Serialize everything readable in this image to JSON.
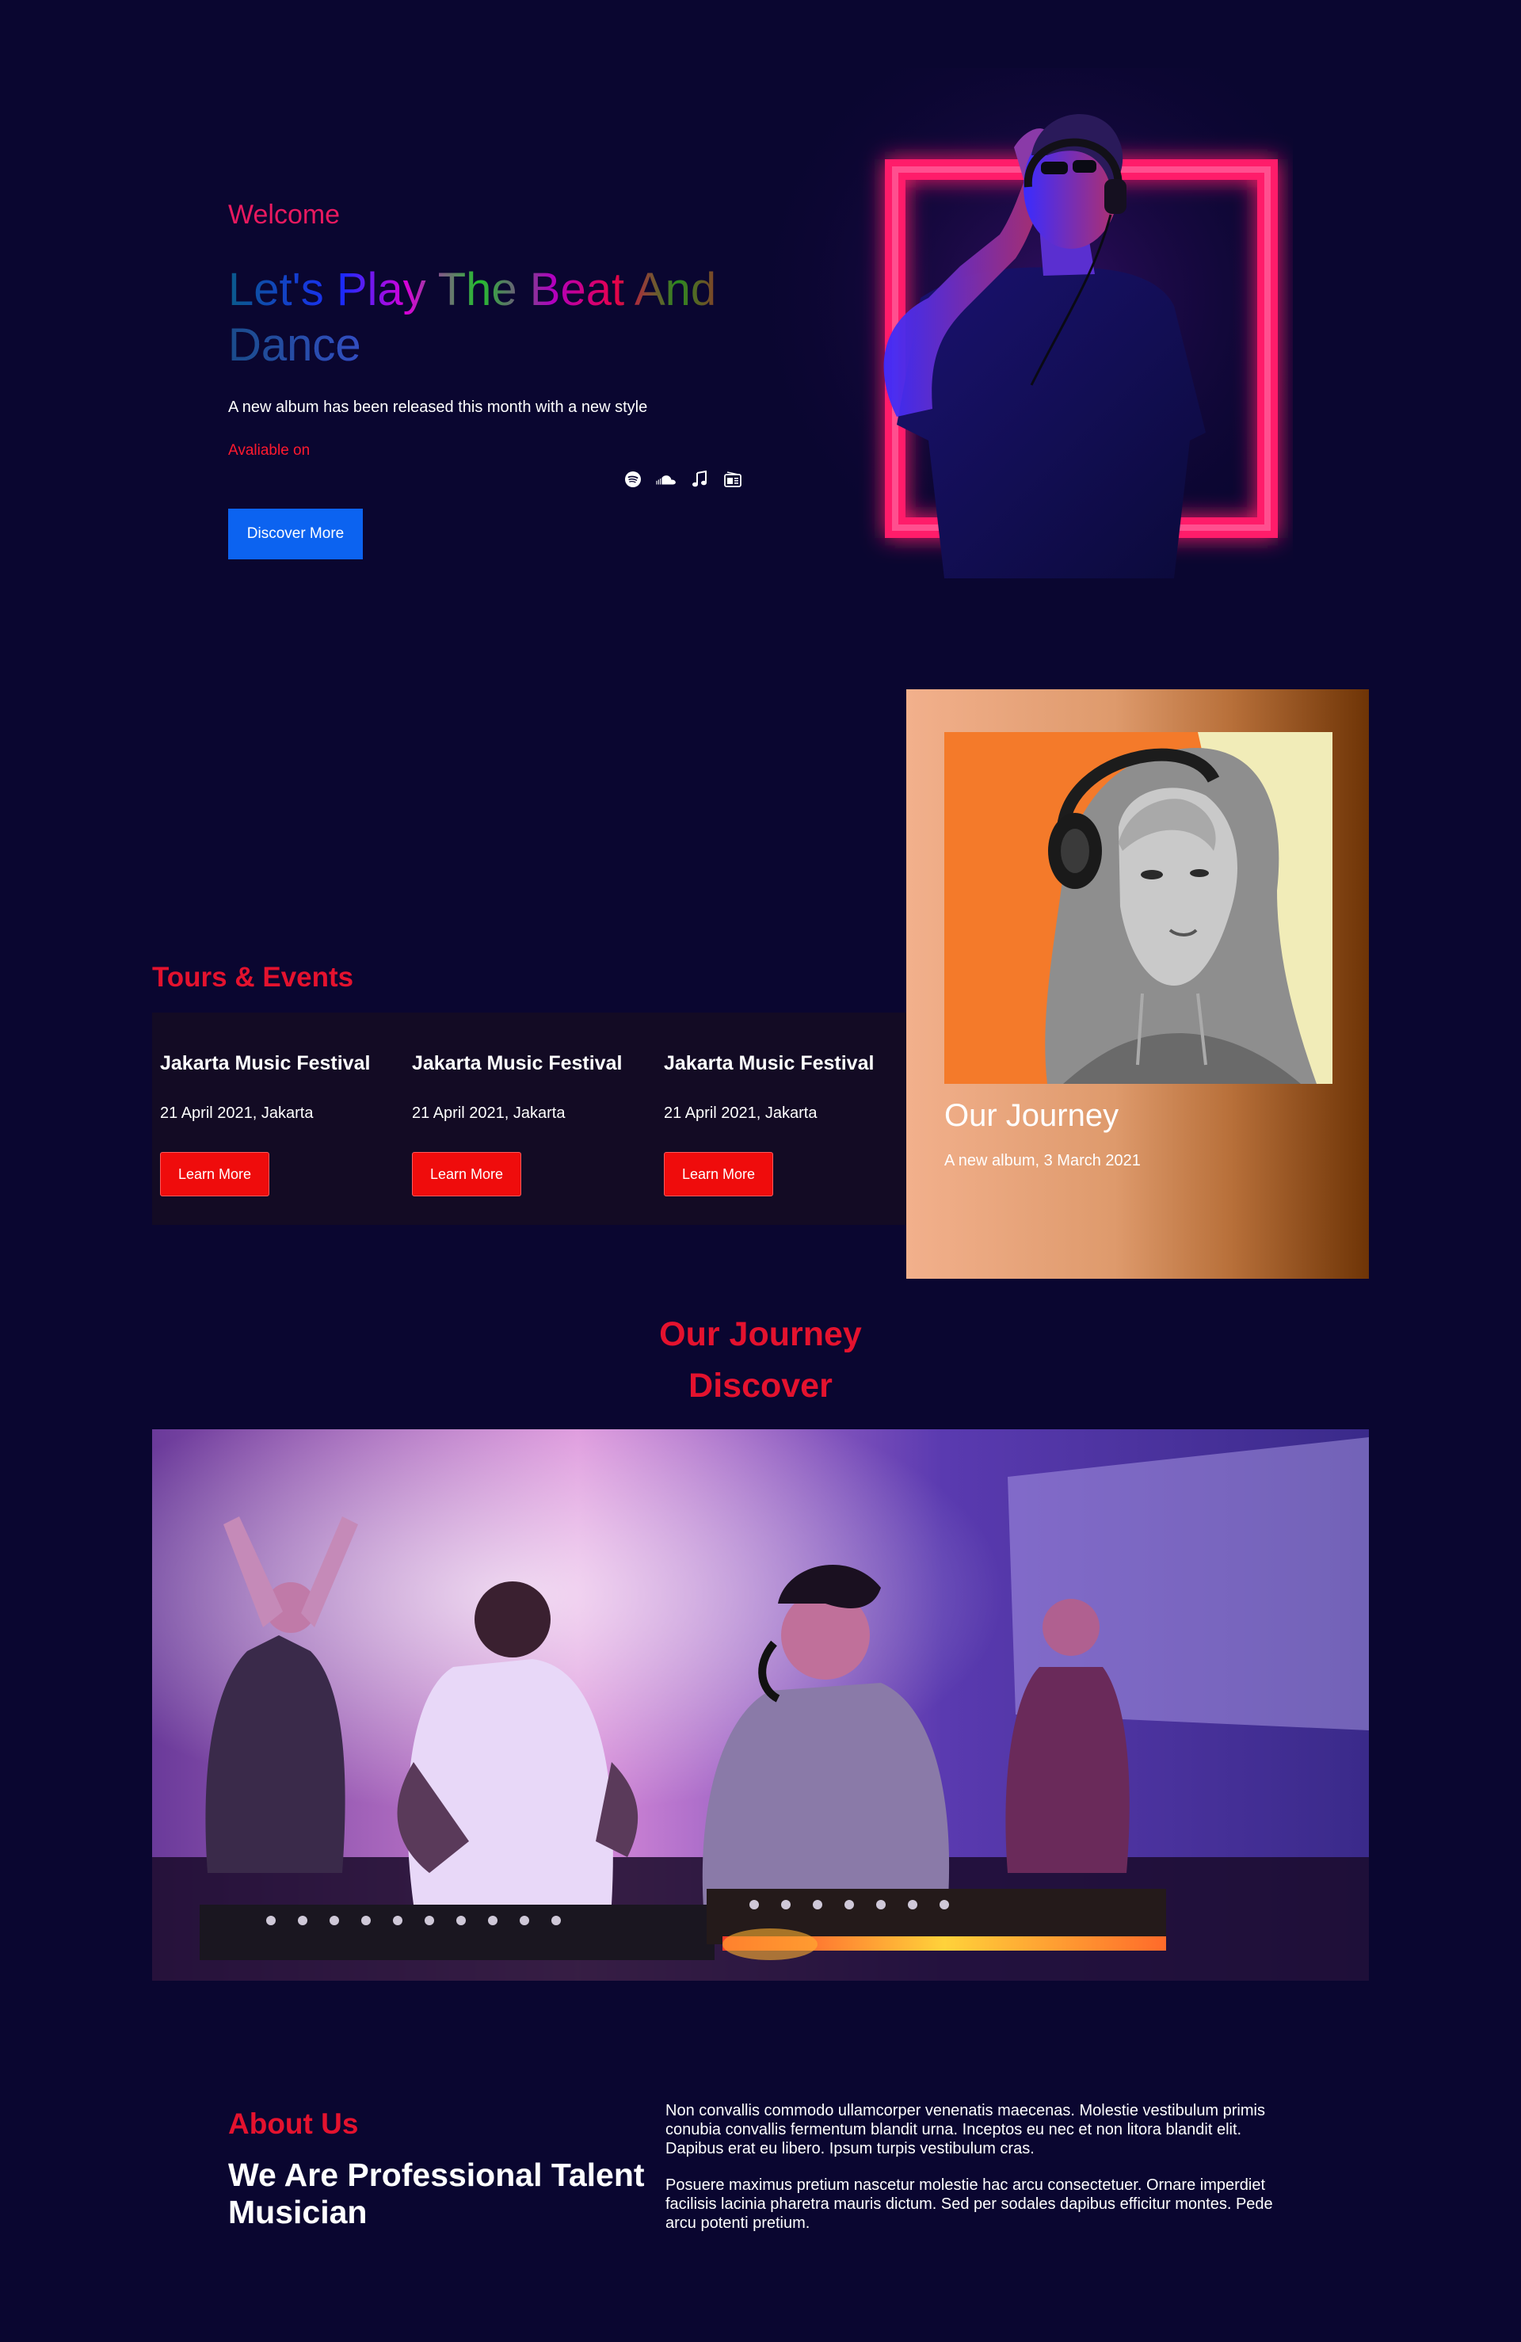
{
  "hero": {
    "welcome": "Welcome",
    "headline_line1": "Let's Play The Beat And",
    "headline_line2": "Dance",
    "subtitle": "A new album has been released this month with a new style",
    "available": "Avaliable on",
    "platforms": [
      "spotify-icon",
      "soundcloud-icon",
      "music-note-icon",
      "radio-icon"
    ],
    "cta": "Discover More"
  },
  "tours": {
    "title": "Tours & Events",
    "items": [
      {
        "name": "Jakarta Music Festival",
        "date": "21 April 2021, Jakarta",
        "button": "Learn More"
      },
      {
        "name": "Jakarta Music Festival",
        "date": "21 April 2021, Jakarta",
        "button": "Learn More"
      },
      {
        "name": "Jakarta Music Festival",
        "date": "21 April 2021, Jakarta",
        "button": "Learn More"
      }
    ]
  },
  "journey_card": {
    "title": "Our Journey",
    "subtitle": "A new album, 3 March 2021"
  },
  "journey_section": {
    "title": "Our Journey",
    "subtitle": "Discover"
  },
  "about": {
    "label": "About Us",
    "title": "We Are Professional Talent Musician",
    "paragraph1": "Non convallis commodo ullamcorper venenatis maecenas. Molestie vestibulum primis conubia convallis fermentum blandit urna. Inceptos eu nec et non litora blandit elit. Dapibus erat eu libero. Ipsum turpis vestibulum cras.",
    "paragraph2": "Posuere maximus pretium nascetur molestie hac arcu consectetuer. Ornare imperdiet facilisis lacinia pharetra mauris dictum. Sed per sodales dapibus efficitur montes. Pede arcu potenti pretium."
  },
  "colors": {
    "background": "#0a0630",
    "accent_red": "#e4122e",
    "accent_pink": "#e8195f",
    "cta_blue": "#0c63f0",
    "tour_panel": "#130b24"
  }
}
